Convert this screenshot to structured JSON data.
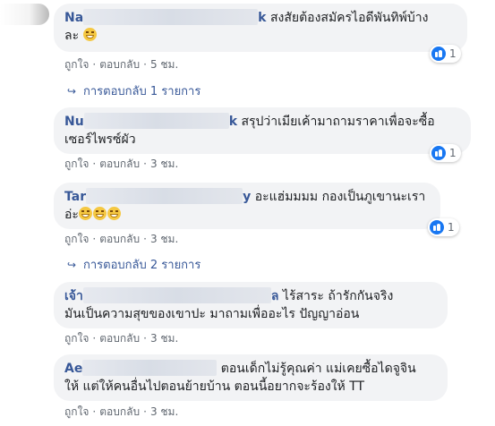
{
  "comments": [
    {
      "name_visible": "Na",
      "name_tail": "k",
      "text": "สงสัยต้องสมัครไอดีพันทิพ์บ้าง",
      "text_line2": "ละ",
      "emoji": "thinking-emoji",
      "reaction_count": "1",
      "like": "ถูกใจ",
      "reply": "ตอบกลับ",
      "time": "5 ชม.",
      "replies_label": "การตอบกลับ 1 รายการ"
    },
    {
      "name_visible": "Nu",
      "name_tail": "k",
      "text": "สรุปว่าเมียเค้ามาถามราคาเพื่อจะซื้อ",
      "text_line2": "เซอร์ไพรซ์ผัว",
      "reaction_count": "1",
      "like": "ถูกใจ",
      "reply": "ตอบกลับ",
      "time": "3 ชม."
    },
    {
      "name_visible": "Tar",
      "name_tail": "y",
      "text": "อะแฮ่มมมม กองเป็นภูเขานะเรา",
      "text_line2": "อ่ะ",
      "emoji": "grinning-emoji",
      "reaction_count": "1",
      "like": "ถูกใจ",
      "reply": "ตอบกลับ",
      "time": "3 ชม.",
      "replies_label": "การตอบกลับ 2 รายการ"
    },
    {
      "name_visible": "เจ้า",
      "name_tail": "ล",
      "text": "ไร้สาระ ถ้ารักกันจริง",
      "text_line2": "มันเป็นความสุขของเขาปะ มาถามเพื่ออะไร ปัญญาอ่อน",
      "like": "ถูกใจ",
      "reply": "ตอบกลับ",
      "time": "3 ชม."
    },
    {
      "name_visible": "Ae",
      "name_tail": "",
      "text": "ตอนเด็กไม่รู้คุณค่า แม่เคยซื้อไดจูจิน",
      "text_line2": "ให้ แต่ให้คนอื่นไปตอนย้ายบ้าน ตอนนี้อยากจะร้องให้ TT",
      "like": "ถูกใจ",
      "reply": "ตอบกลับ",
      "time": "3 ชม."
    }
  ],
  "colors": {
    "name": "#385898",
    "bubble": "#f2f3f5",
    "meta": "#606770",
    "like_blue": "#1877f2"
  }
}
